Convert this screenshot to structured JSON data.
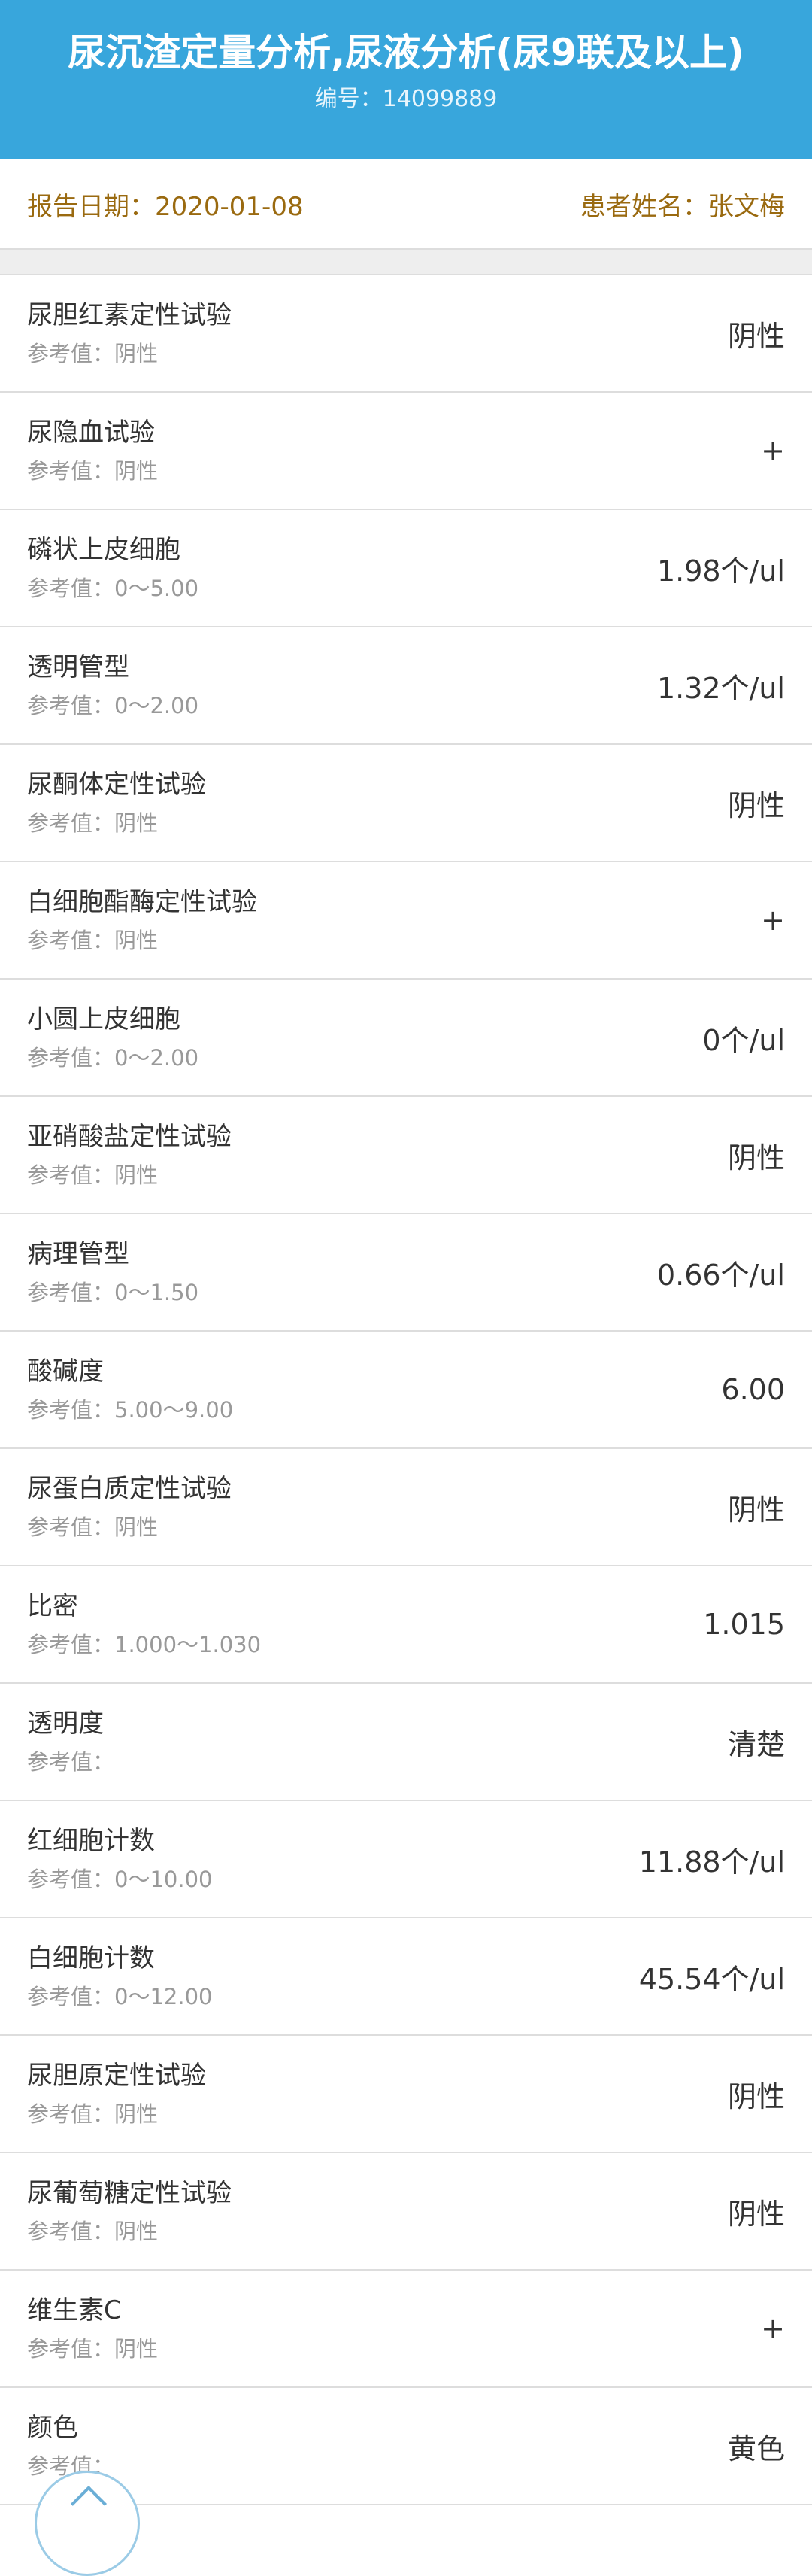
{
  "header": {
    "title": "尿沉渣定量分析,尿液分析(尿9联及以上)",
    "number_label": "编号：",
    "number": "14099889"
  },
  "meta": {
    "report_date_label": "报告日期：",
    "report_date": "2020-01-08",
    "patient_label": "患者姓名：",
    "patient_name": "张文梅"
  },
  "colors": {
    "header_bg": "#38a6dc",
    "meta_text": "#9a6a10"
  },
  "ref_label": "参考值：",
  "items": [
    {
      "name": "尿胆红素定性试验",
      "ref": "阴性",
      "value": "阴性"
    },
    {
      "name": "尿隐血试验",
      "ref": "阴性",
      "value": "+"
    },
    {
      "name": "磷状上皮细胞",
      "ref": "0～5.00",
      "value": "1.98个/ul"
    },
    {
      "name": "透明管型",
      "ref": "0～2.00",
      "value": "1.32个/ul"
    },
    {
      "name": "尿酮体定性试验",
      "ref": "阴性",
      "value": "阴性"
    },
    {
      "name": "白细胞酯酶定性试验",
      "ref": "阴性",
      "value": "+"
    },
    {
      "name": "小圆上皮细胞",
      "ref": "0～2.00",
      "value": "0个/ul"
    },
    {
      "name": "亚硝酸盐定性试验",
      "ref": "阴性",
      "value": "阴性"
    },
    {
      "name": "病理管型",
      "ref": "0～1.50",
      "value": "0.66个/ul"
    },
    {
      "name": "酸碱度",
      "ref": "5.00～9.00",
      "value": "6.00"
    },
    {
      "name": "尿蛋白质定性试验",
      "ref": "阴性",
      "value": "阴性"
    },
    {
      "name": "比密",
      "ref": "1.000～1.030",
      "value": "1.015"
    },
    {
      "name": "透明度",
      "ref": "",
      "value": "清楚"
    },
    {
      "name": "红细胞计数",
      "ref": "0～10.00",
      "value": "11.88个/ul"
    },
    {
      "name": "白细胞计数",
      "ref": "0～12.00",
      "value": "45.54个/ul"
    },
    {
      "name": "尿胆原定性试验",
      "ref": "阴性",
      "value": "阴性"
    },
    {
      "name": "尿葡萄糖定性试验",
      "ref": "阴性",
      "value": "阴性"
    },
    {
      "name": "维生素C",
      "ref": "阴性",
      "value": "+"
    },
    {
      "name": "颜色",
      "ref": "",
      "value": "黄色"
    }
  ],
  "fab_icon": "chevron-up-icon"
}
